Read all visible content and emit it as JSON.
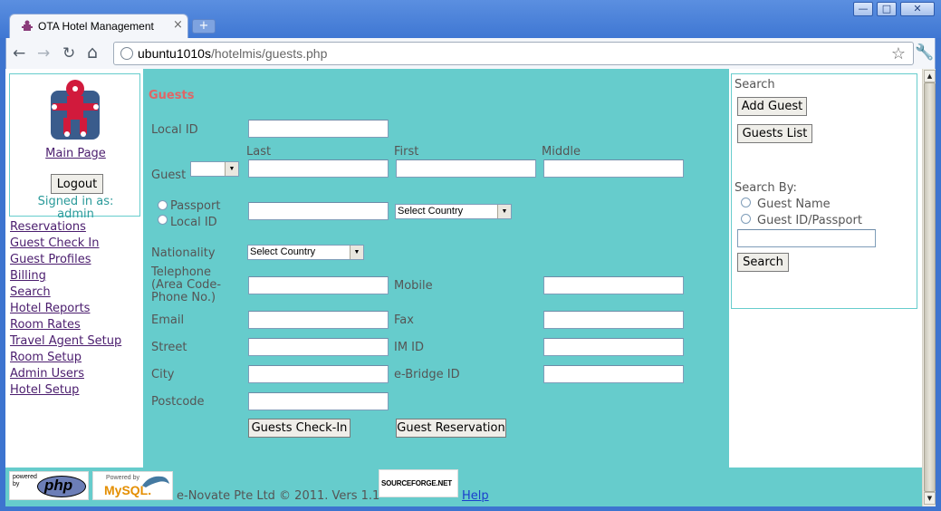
{
  "browser": {
    "tab_title": "OTA Hotel Management",
    "tab_close": "×",
    "new_tab": "+",
    "url_host": "ubuntu1010s",
    "url_path": "/hotelmis/guests.php",
    "back": "←",
    "forward": "→",
    "reload": "↻",
    "home": "⌂",
    "star": "☆",
    "wrench": "🔧",
    "minimize": "—",
    "maximize": "□",
    "close": "✕"
  },
  "sidebar": {
    "main_page": "Main Page",
    "logout": "Logout",
    "signed_in_label": "Signed in as:",
    "signed_in_user": "admin",
    "links": [
      "Reservations",
      "Guest Check In",
      "Guest Profiles",
      "Billing",
      "Search",
      "Hotel Reports",
      "Room Rates",
      "Travel Agent Setup",
      "Room Setup",
      "Admin Users",
      "Hotel Setup"
    ]
  },
  "form": {
    "title": "Guests",
    "local_id_label": "Local ID",
    "local_id_value": "",
    "last_label": "Last",
    "first_label": "First",
    "middle_label": "Middle",
    "guest_label": "Guest",
    "guest_title_value": "",
    "last_value": "",
    "first_value": "",
    "middle_value": "",
    "passport_label": "Passport",
    "local_id_radio_label": "Local ID",
    "id_number_value": "",
    "country_select": "Select Country",
    "nationality_label": "Nationality",
    "nationality_select": "Select Country",
    "telephone_label_1": "Telephone",
    "telephone_label_2": "(Area Code-",
    "telephone_label_3": "Phone No.)",
    "telephone_value": "",
    "mobile_label": "Mobile",
    "mobile_value": "",
    "email_label": "Email",
    "email_value": "",
    "fax_label": "Fax",
    "fax_value": "",
    "street_label": "Street",
    "street_value": "",
    "im_label": "IM ID",
    "im_value": "",
    "city_label": "City",
    "city_value": "",
    "ebridge_label": "e-Bridge ID",
    "ebridge_value": "",
    "postcode_label": "Postcode",
    "postcode_value": "",
    "checkin_button": "Guests Check-In",
    "reservation_button": "Guest Reservation"
  },
  "search_panel": {
    "heading": "Search",
    "add_guest": "Add Guest",
    "guests_list": "Guests List",
    "search_by": "Search By:",
    "option_name": "Guest Name",
    "option_id": "Guest ID/Passport",
    "query_value": "",
    "search_button": "Search"
  },
  "footer": {
    "php_powered": "powered",
    "php_by": "by",
    "php_logo": "php",
    "mysql_powered": "Powered by",
    "mysql_logo": "MySQL.",
    "copyright": "e-Novate Pte Ltd © 2011. Vers 1.1",
    "sourceforge": "SOURCEFORGE.NET",
    "help": "Help"
  },
  "colors": {
    "page_teal": "#66cccc",
    "title_red": "#e06666",
    "link_purple": "#4b1d6e",
    "chrome_blue": "#3d74cf"
  }
}
